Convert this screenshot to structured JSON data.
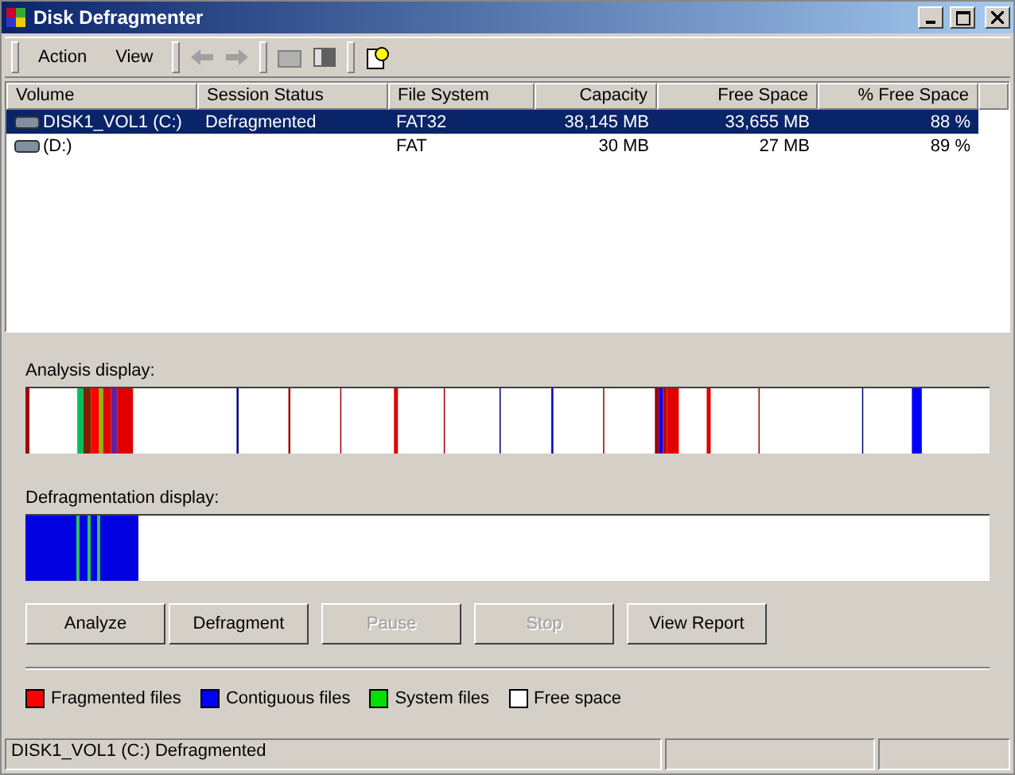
{
  "window": {
    "title": "Disk Defragmenter"
  },
  "menu": [
    {
      "label": "Action"
    },
    {
      "label": "View"
    }
  ],
  "table": {
    "columns": [
      "Volume",
      "Session Status",
      "File System",
      "Capacity",
      "Free Space",
      "% Free Space"
    ],
    "rows": [
      {
        "selected": true,
        "cells": [
          "DISK1_VOL1 (C:)",
          "Defragmented",
          "FAT32",
          "38,145 MB",
          "33,655 MB",
          "88 %"
        ]
      },
      {
        "selected": false,
        "cells": [
          "(D:)",
          "",
          "FAT",
          "30 MB",
          "27 MB",
          "89 %"
        ]
      }
    ]
  },
  "analysis": {
    "label": "Analysis display:"
  },
  "defrag": {
    "label": "Defragmentation display:"
  },
  "buttons": [
    {
      "label": "Analyze",
      "disabled": false
    },
    {
      "label": "Defragment",
      "disabled": false
    },
    {
      "label": "Pause",
      "disabled": true
    },
    {
      "label": "Stop",
      "disabled": true
    },
    {
      "label": "View Report",
      "disabled": false
    }
  ],
  "legend": [
    {
      "label": "Fragmented files",
      "color": "#ff0000"
    },
    {
      "label": "Contiguous files",
      "color": "#0000ff"
    },
    {
      "label": "System files",
      "color": "#00e000"
    },
    {
      "label": "Free space",
      "color": "#ffffff"
    }
  ],
  "status_bar": [
    "DISK1_VOL1 (C:) Defragmented"
  ]
}
